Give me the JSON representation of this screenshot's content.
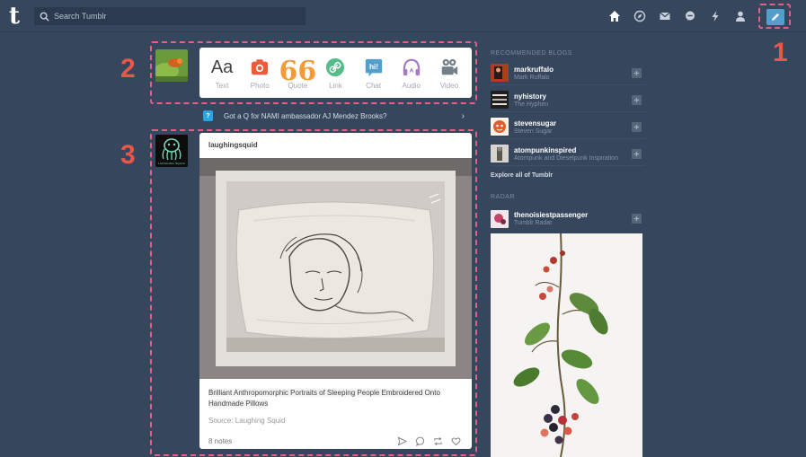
{
  "header": {
    "logo": "t",
    "search_placeholder": "Search Tumblr",
    "icons": [
      "home-icon",
      "explore-icon",
      "inbox-icon",
      "messaging-icon",
      "activity-icon",
      "account-icon"
    ],
    "compose_icon": "pencil-icon"
  },
  "annotations": {
    "one": "1",
    "two": "2",
    "three": "3"
  },
  "composer": {
    "types": [
      {
        "label": "Text",
        "icon": "text-icon",
        "color": "#444444"
      },
      {
        "label": "Photo",
        "icon": "camera-icon",
        "color": "#f05a3c"
      },
      {
        "label": "Quote",
        "icon": "quote-icon",
        "color": "#f29b38"
      },
      {
        "label": "Link",
        "icon": "link-icon",
        "color": "#56bc8a"
      },
      {
        "label": "Chat",
        "icon": "chat-icon",
        "color": "#529ecc"
      },
      {
        "label": "Audio",
        "icon": "headphones-icon",
        "color": "#a77dc2"
      },
      {
        "label": "Video",
        "icon": "video-camera-icon",
        "color": "#748089"
      }
    ]
  },
  "notice": {
    "text": "Got a Q for NAMI ambassador AJ Mendez Brooks?"
  },
  "post": {
    "blog_name": "laughingsquid",
    "avatar_label": "LAUGHING SQUID",
    "caption": "Brilliant Anthropomorphic Portraits of Sleeping People Embroidered Onto Handmade Pillows",
    "source": "Source: Laughing Squid",
    "notes": "8 notes"
  },
  "sidebar": {
    "recommended_heading": "RECOMMENDED BLOGS",
    "blogs": [
      {
        "name": "markruffalo",
        "sub": "Mark Ruffalo"
      },
      {
        "name": "nyhistory",
        "sub": "The Hyphen"
      },
      {
        "name": "stevensugar",
        "sub": "Steven Sugar"
      },
      {
        "name": "atompunkinspired",
        "sub": "Atompunk and Dieselpunk Inspiration"
      }
    ],
    "explore": "Explore all of Tumblr",
    "radar_heading": "RADAR",
    "radar": {
      "name": "thenoisiestpassenger",
      "sub": "Tumblr Radar"
    }
  },
  "colors": {
    "background": "#36465d",
    "accent": "#529ecc",
    "annotation": "#e8574a"
  }
}
